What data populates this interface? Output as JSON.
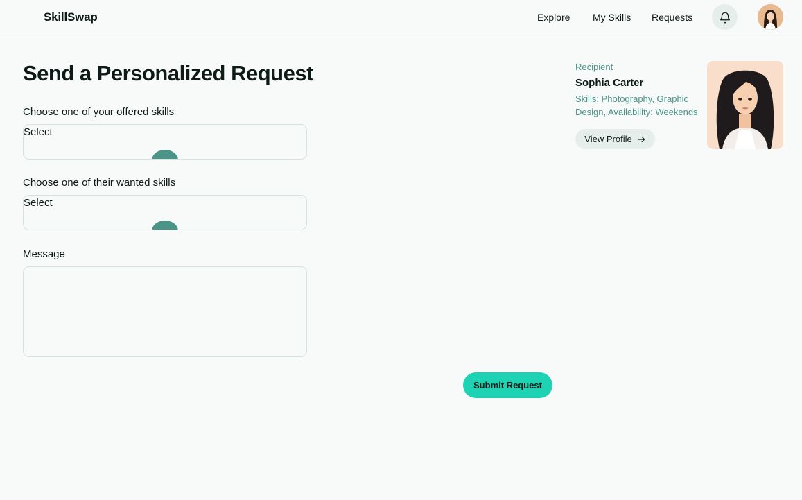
{
  "header": {
    "brand": "SkillSwap",
    "nav": [
      {
        "label": "Explore"
      },
      {
        "label": "My Skills"
      },
      {
        "label": "Requests"
      }
    ],
    "bell_icon": "bell-icon"
  },
  "form": {
    "title": "Send a Personalized Request",
    "offered_label": "Choose one of your offered skills",
    "offered_value": "Select",
    "wanted_label": "Choose one of their wanted skills",
    "wanted_value": "Select",
    "message_label": "Message",
    "message_value": "",
    "submit_label": "Submit Request"
  },
  "recipient": {
    "tag": "Recipient",
    "name": "Sophia Carter",
    "details": "Skills: Photography, Graphic Design, Availability: Weekends",
    "view_profile_label": "View Profile",
    "arrow_icon": "arrow-right-icon"
  },
  "colors": {
    "background": "#f7faf9",
    "accent": "#1ed3b4",
    "muted_teal": "#4a9488",
    "chip_bg": "#e6eeec"
  }
}
